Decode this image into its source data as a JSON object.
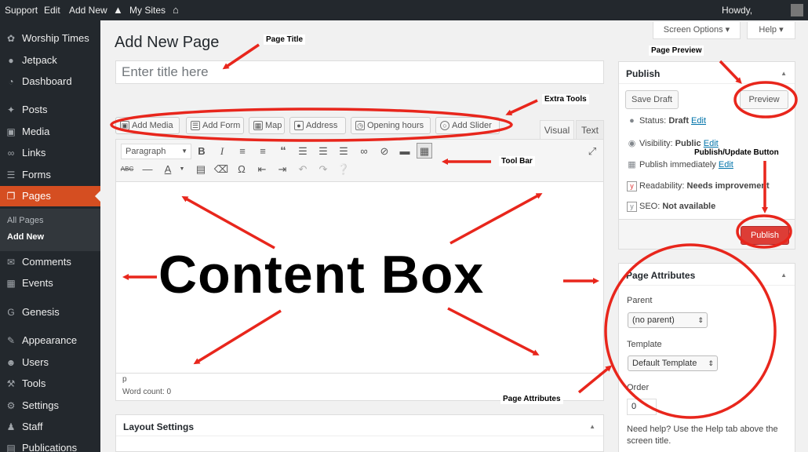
{
  "admin_bar": {
    "items": [
      "Support",
      "Edit",
      "Add New",
      "My Sites"
    ],
    "howdy": "Howdy,"
  },
  "sidebar": {
    "items": [
      {
        "label": "Worship Times",
        "icon": "leaf-icon"
      },
      {
        "label": "Jetpack",
        "icon": "jetpack-icon"
      },
      {
        "label": "Dashboard",
        "icon": "dashboard-icon"
      },
      {
        "label": "Posts",
        "icon": "pin-icon"
      },
      {
        "label": "Media",
        "icon": "media-icon"
      },
      {
        "label": "Links",
        "icon": "link-icon"
      },
      {
        "label": "Forms",
        "icon": "forms-icon"
      },
      {
        "label": "Pages",
        "icon": "pages-icon"
      },
      {
        "label": "Comments",
        "icon": "comment-icon"
      },
      {
        "label": "Events",
        "icon": "calendar-icon"
      },
      {
        "label": "Genesis",
        "icon": "genesis-icon"
      },
      {
        "label": "Appearance",
        "icon": "brush-icon"
      },
      {
        "label": "Users",
        "icon": "user-icon"
      },
      {
        "label": "Tools",
        "icon": "wrench-icon"
      },
      {
        "label": "Settings",
        "icon": "settings-icon"
      },
      {
        "label": "Staff",
        "icon": "staff-icon"
      },
      {
        "label": "Publications",
        "icon": "publications-icon"
      }
    ],
    "submenu": [
      "All Pages",
      "Add New"
    ],
    "active_color": "#d54e21"
  },
  "top_buttons": {
    "screen_options": "Screen Options ▾",
    "help": "Help ▾"
  },
  "page": {
    "heading": "Add New Page",
    "title_placeholder": "Enter title here"
  },
  "media_buttons": [
    "Add Media",
    "Add Form",
    "Map",
    "Address",
    "Opening hours",
    "Add Slider"
  ],
  "editor": {
    "tabs": [
      "Visual",
      "Text"
    ],
    "format": "Paragraph",
    "path": "p",
    "word_count": "Word count: 0"
  },
  "publish": {
    "title": "Publish",
    "save_draft": "Save Draft",
    "preview": "Preview",
    "status_label": "Status:",
    "status_value": "Draft",
    "visibility_label": "Visibility:",
    "visibility_value": "Public",
    "schedule": "Publish immediately",
    "edit": "Edit",
    "readability_label": "Readability:",
    "readability_value": "Needs improvement",
    "seo_label": "SEO:",
    "seo_value": "Not available",
    "publish_button": "Publish"
  },
  "page_attributes": {
    "title": "Page Attributes",
    "parent_label": "Parent",
    "parent_value": "(no parent)",
    "template_label": "Template",
    "template_value": "Default Template",
    "order_label": "Order",
    "order_value": "0",
    "help_text": "Need help? Use the Help tab above the screen title."
  },
  "layout_settings": {
    "title": "Layout Settings"
  },
  "annotations": {
    "page_title": "Page Title",
    "page_preview": "Page Preview",
    "extra_tools": "Extra Tools",
    "tool_bar": "Tool Bar",
    "publish_update": "Publish/Update Button",
    "page_attributes": "Page Attributes",
    "content_box": "Content Box",
    "arrow_color": "#e8261c"
  }
}
